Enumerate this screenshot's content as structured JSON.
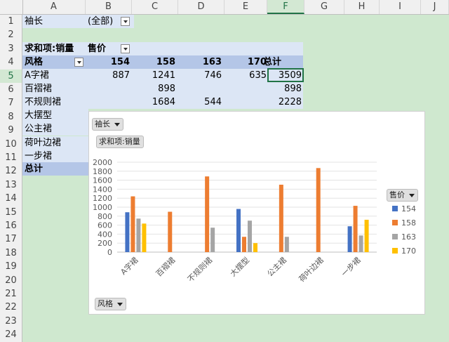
{
  "columns": [
    "A",
    "B",
    "C",
    "D",
    "E",
    "F",
    "G",
    "H",
    "I",
    "J"
  ],
  "rows": [
    "1",
    "2",
    "3",
    "4",
    "5",
    "6",
    "7",
    "8",
    "9",
    "10",
    "11",
    "12",
    "13",
    "14",
    "15",
    "16",
    "17",
    "18",
    "19",
    "20",
    "21",
    "22",
    "23",
    "24"
  ],
  "selected_column": "F",
  "selected_row": "5",
  "pivot": {
    "filter_label": "袖长",
    "filter_value": "(全部)",
    "value_field": "求和项:销量",
    "col_field": "售价",
    "row_field": "风格",
    "col_headers": [
      "154",
      "158",
      "163",
      "170"
    ],
    "total_label": "总计",
    "rows": [
      {
        "label": "A字裙",
        "values": [
          "887",
          "1241",
          "746",
          "635"
        ],
        "total": "3509"
      },
      {
        "label": "百褶裙",
        "values": [
          "",
          "898",
          "",
          ""
        ],
        "total": "898"
      },
      {
        "label": "不规则裙",
        "values": [
          "",
          "1684",
          "544",
          ""
        ],
        "total": "2228"
      },
      {
        "label": "大摆型",
        "values": [
          "",
          "",
          "",
          ""
        ],
        "total": ""
      },
      {
        "label": "公主裙",
        "values": [
          "",
          "",
          "",
          ""
        ],
        "total": ""
      },
      {
        "label": "荷叶边裙",
        "values": [
          "",
          "",
          "",
          ""
        ],
        "total": ""
      },
      {
        "label": "一步裙",
        "values": [
          "",
          "",
          "",
          ""
        ],
        "total": ""
      }
    ]
  },
  "chart_buttons": {
    "filter": "袖长",
    "value": "求和项:销量",
    "legend": "售价",
    "axis": "风格"
  },
  "chart_data": {
    "type": "bar",
    "categories": [
      "A字裙",
      "百褶裙",
      "不规则裙",
      "大摆型",
      "公主裙",
      "荷叶边裙",
      "一步裙"
    ],
    "series": [
      {
        "name": "154",
        "color": "#4472c4",
        "values": [
          887,
          null,
          null,
          960,
          null,
          null,
          575
        ]
      },
      {
        "name": "158",
        "color": "#ed7d31",
        "values": [
          1241,
          898,
          1684,
          340,
          1500,
          1870,
          1030
        ]
      },
      {
        "name": "163",
        "color": "#a5a5a5",
        "values": [
          746,
          null,
          544,
          700,
          340,
          null,
          370
        ]
      },
      {
        "name": "170",
        "color": "#ffc000",
        "values": [
          635,
          null,
          null,
          200,
          null,
          null,
          720
        ]
      }
    ],
    "ylim": [
      0,
      2000
    ],
    "yticks": [
      0,
      200,
      400,
      600,
      800,
      1000,
      1200,
      1400,
      1600,
      1800,
      2000
    ],
    "grid": true,
    "legend_position": "right"
  }
}
